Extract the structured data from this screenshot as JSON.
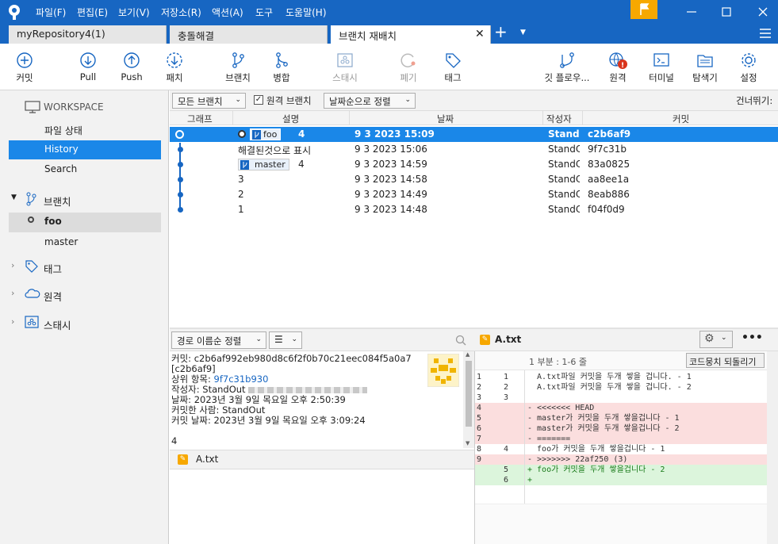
{
  "menu": [
    "파일(F)",
    "편집(E)",
    "보기(V)",
    "저장소(R)",
    "액션(A)",
    "도구",
    "도움말(H)"
  ],
  "tabs": [
    {
      "label": "myRepository4(1)"
    },
    {
      "label": "충돌해결"
    },
    {
      "label": "브랜치 재배치"
    }
  ],
  "toolbar": {
    "commit": "커밋",
    "pull": "Pull",
    "push": "Push",
    "patch": "패치",
    "branch": "브랜치",
    "merge": "병합",
    "stash": "스태시",
    "discard": "폐기",
    "tag": "태그",
    "gitflow": "깃 플로우...",
    "remote": "원격",
    "terminal": "터미널",
    "explorer": "탐색기",
    "settings": "설정"
  },
  "sidebar": {
    "workspace": "WORKSPACE",
    "file_status": "파일 상태",
    "history": "History",
    "search": "Search",
    "branches": "브랜치",
    "branch_items": [
      "foo",
      "master"
    ],
    "tags": "태그",
    "remotes": "원격",
    "stashes": "스태시"
  },
  "filter": {
    "all_branches": "모든 브랜치",
    "remote_branches": "원격 브랜치",
    "sort": "날짜순으로 정렬",
    "jump": "건너뛰기:"
  },
  "columns": {
    "graph": "그래프",
    "desc": "설명",
    "date": "날짜",
    "author": "작성자",
    "commit": "커밋"
  },
  "commits": [
    {
      "desc": "4",
      "branch": "foo",
      "date": "9 3 2023 15:09",
      "author": "StandC",
      "hash": "c2b6af9"
    },
    {
      "desc": "해결된것으로 표시",
      "date": "9 3 2023 15:06",
      "author": "StandC",
      "hash": "9f7c31b"
    },
    {
      "desc": "4",
      "branch": "master",
      "date": "9 3 2023 14:59",
      "author": "StandC",
      "hash": "83a0825"
    },
    {
      "desc": "3",
      "date": "9 3 2023 14:58",
      "author": "StandC",
      "hash": "aa8ee1a"
    },
    {
      "desc": "2",
      "date": "9 3 2023 14:49",
      "author": "StandC",
      "hash": "8eab886"
    },
    {
      "desc": "1",
      "date": "9 3 2023 14:48",
      "author": "StandC",
      "hash": "f04f0d9"
    }
  ],
  "lower": {
    "sort_path": "경로 이름순 정렬"
  },
  "details": {
    "commit_line": "커밋: c2b6af992eb980d8c6f2f0b70c21eec084f5a0a7",
    "short": "[c2b6af9]",
    "parent_label": "상위 항목:",
    "parent_hash": "9f7c31b930",
    "author": "작성자: StandOut",
    "date": "날짜: 2023년 3월 9일 목요일 오후 2:50:39",
    "committer": "커밋한 사람: StandOut",
    "commit_date": "커밋 날짜: 2023년 3월 9일 목요일 오후 3:09:24",
    "message": "4"
  },
  "files": [
    {
      "name": "A.txt"
    }
  ],
  "diff": {
    "file": "A.txt",
    "hunk": "1 부분 : 1-6 줄",
    "revert": "코드뭉치 되돌리기",
    "lines": [
      {
        "n1": "1",
        "n2": "1",
        "t": "  A.txt파일 커밋을 두개 쌓을 겁니다. - 1",
        "k": "ctx"
      },
      {
        "n1": "2",
        "n2": "2",
        "t": "  A.txt파일 커밋을 두개 쌓을 겁니다. - 2",
        "k": "ctx"
      },
      {
        "n1": "3",
        "n2": "3",
        "t": "",
        "k": "ctx"
      },
      {
        "n1": "4",
        "n2": "",
        "t": "- <<<<<<< HEAD",
        "k": "del"
      },
      {
        "n1": "5",
        "n2": "",
        "t": "- master가 커밋을 두개 쌓을겁니다 - 1",
        "k": "del"
      },
      {
        "n1": "6",
        "n2": "",
        "t": "- master가 커밋을 두개 쌓을겁니다 - 2",
        "k": "del"
      },
      {
        "n1": "7",
        "n2": "",
        "t": "- =======",
        "k": "del"
      },
      {
        "n1": "8",
        "n2": "4",
        "t": "  foo가 커밋을 두개 쌓을겁니다 - 1",
        "k": "ctx"
      },
      {
        "n1": "9",
        "n2": "",
        "t": "- >>>>>>> 22af250 (3)",
        "k": "del"
      },
      {
        "n1": "",
        "n2": "5",
        "t": "+ foo가 커밋을 두개 쌓을겁니다 - 2",
        "k": "add"
      },
      {
        "n1": "",
        "n2": "6",
        "t": "+",
        "k": "add"
      }
    ]
  },
  "colors": {
    "accent": "#1766c2",
    "selection": "#1a87e8",
    "flag": "#f7a800"
  }
}
